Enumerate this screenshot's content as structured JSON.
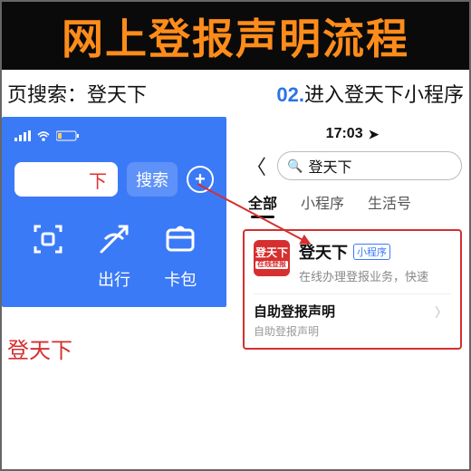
{
  "banner": {
    "title": "网上登报声明流程"
  },
  "steps": {
    "s1_num": "",
    "s1_text": "页搜索：登天下",
    "s2_num": "02.",
    "s2_text": "进入登天下小程序"
  },
  "left": {
    "search_value": "下",
    "search_btn": "搜索",
    "icons": {
      "travel": "出行",
      "card": "卡包"
    },
    "bottom": "登天下"
  },
  "right": {
    "time": "17:03",
    "search_value": "登天下",
    "tabs": {
      "all": "全部",
      "mini": "小程序",
      "life": "生活号"
    },
    "result": {
      "icon_line1": "登天下",
      "icon_line2": "在线登报",
      "title": "登天下",
      "badge": "小程序",
      "subtitle": "在线办理登报业务，快速",
      "item_title": "自助登报声明",
      "item_sub": "自助登报声明"
    }
  }
}
